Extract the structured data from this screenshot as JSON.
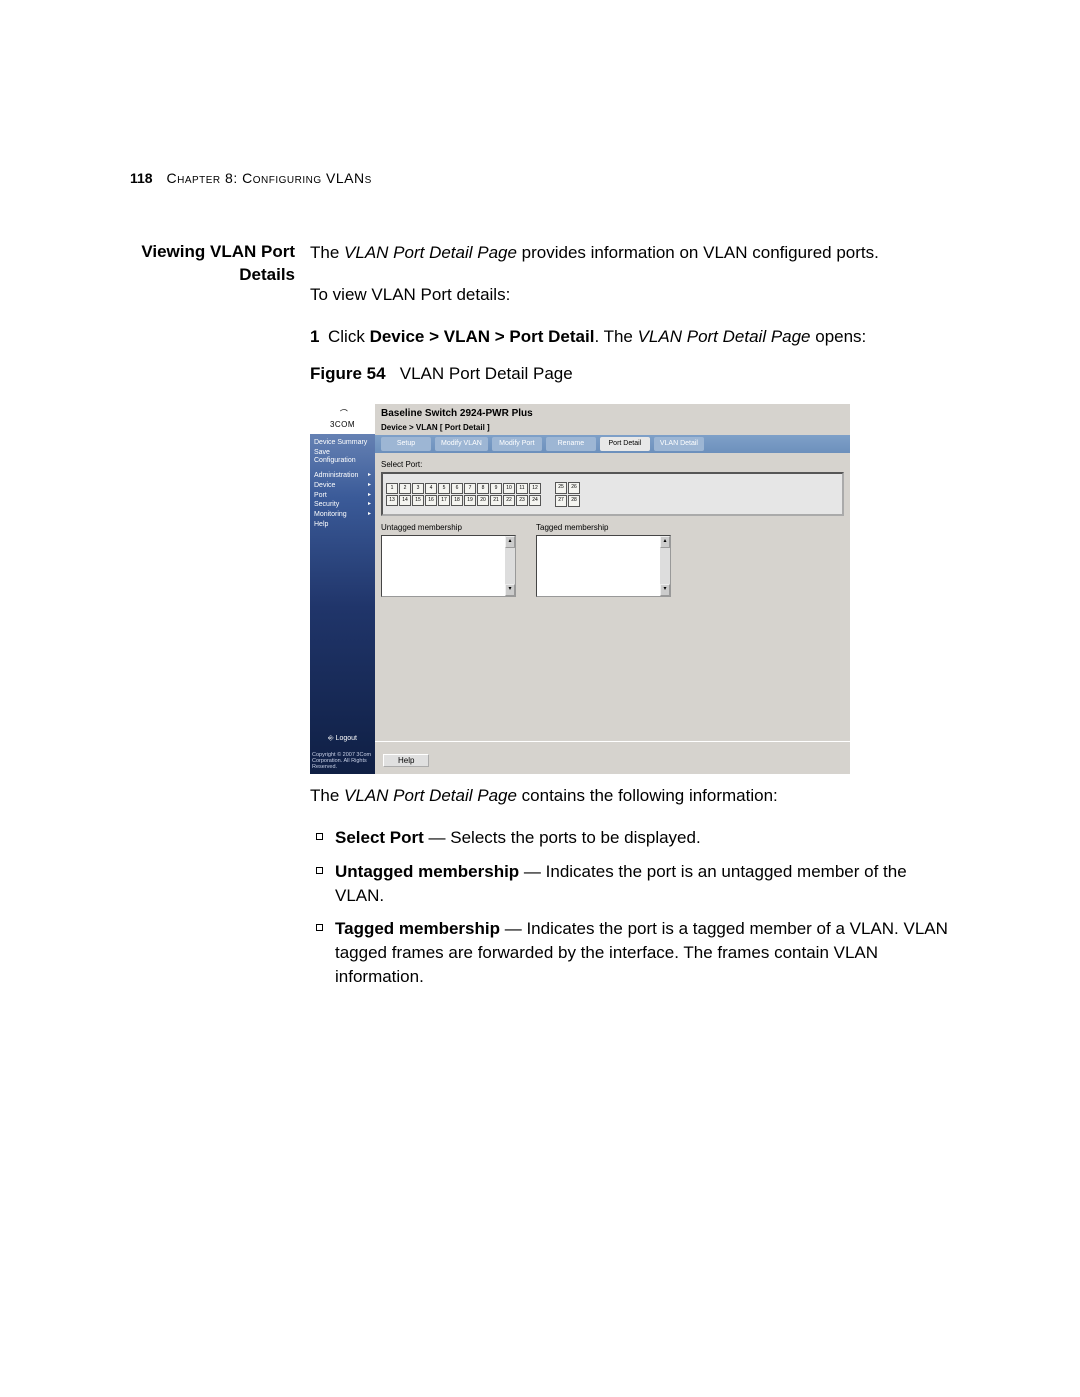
{
  "header": {
    "page_number": "118",
    "chapter": "Chapter 8: Configuring VLANs"
  },
  "section": {
    "heading": "Viewing VLAN Port Details"
  },
  "body": {
    "intro_pre": "The ",
    "intro_em": "VLAN Port Detail Page",
    "intro_post": " provides information on VLAN configured ports.",
    "instruction": "To view VLAN Port details:",
    "step1_num": "1",
    "step1_pre": "Click ",
    "step1_bold": "Device > VLAN > Port Detail",
    "step1_mid": ". The ",
    "step1_em": "VLAN Port Detail Page",
    "step1_post": " opens:",
    "figure_label": "Figure 54",
    "figure_caption": "VLAN Port Detail Page",
    "after_fig_pre": "The ",
    "after_fig_em": "VLAN Port Detail Page",
    "after_fig_post": " contains the following information:",
    "bullets": [
      {
        "term": "Select Port",
        "text": " — Selects the ports to be displayed."
      },
      {
        "term": "Untagged membership",
        "text": " — Indicates the port is an untagged member of the VLAN."
      },
      {
        "term": "Tagged membership",
        "text": " — Indicates the port is a tagged member of a VLAN. VLAN tagged frames are forwarded by the interface. The frames contain VLAN information."
      }
    ]
  },
  "ui": {
    "brand_top": "⌒",
    "brand": "3COM",
    "title": "Baseline Switch 2924-PWR Plus",
    "breadcrumb": "Device > VLAN [ Port Detail ]",
    "tabs": [
      "Setup",
      "Modify VLAN",
      "Modify Port",
      "Rename",
      "Port Detail",
      "VLAN Detail"
    ],
    "active_tab_index": 4,
    "sidebar": {
      "items_top": [
        "Device Summary",
        "Save Configuration"
      ],
      "items": [
        "Administration",
        "Device",
        "Port",
        "Security",
        "Monitoring",
        "Help"
      ],
      "logout": "Logout",
      "copyright": "Copyright © 2007 3Com Corporation. All Rights Reserved."
    },
    "select_port_label": "Select Port:",
    "ports_top": [
      "1",
      "2",
      "3",
      "4",
      "5",
      "6",
      "7",
      "8",
      "9",
      "10",
      "11",
      "12"
    ],
    "ports_bottom": [
      "13",
      "14",
      "15",
      "16",
      "17",
      "18",
      "19",
      "20",
      "21",
      "22",
      "23",
      "24"
    ],
    "ports_extra_top": [
      "25",
      "26"
    ],
    "ports_extra_bottom": [
      "27",
      "28"
    ],
    "untagged_label": "Untagged membership",
    "tagged_label": "Tagged membership",
    "help_button": "Help"
  }
}
